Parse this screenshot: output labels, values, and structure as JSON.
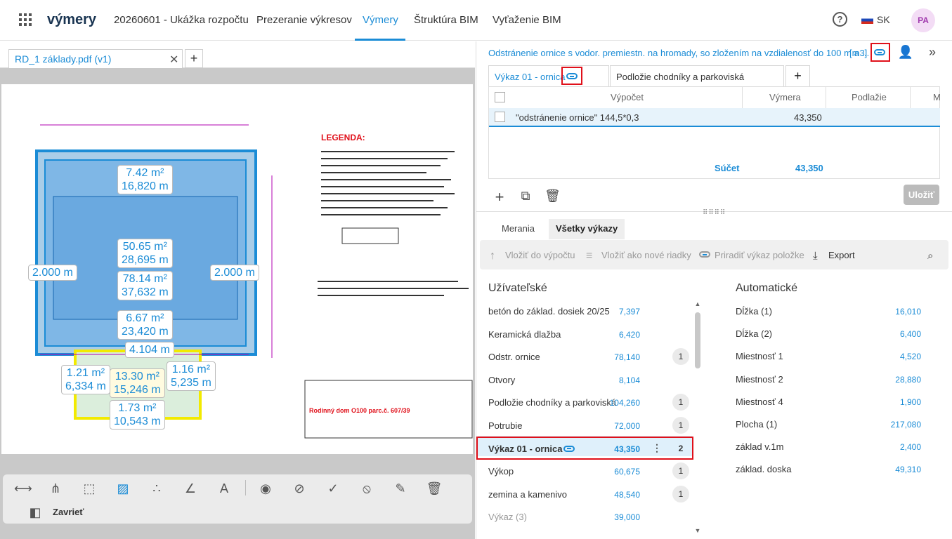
{
  "app": {
    "logo": "výmery",
    "project": "20260601 - Ukážka rozpočtu",
    "lang": "SK",
    "user": "PA"
  },
  "nav": [
    "Prezeranie výkresov",
    "Výmery",
    "Štruktúra BIM",
    "Vyťaženie BIM"
  ],
  "file_tab": {
    "label": "RD_1 základy.pdf (v1)",
    "add": "+"
  },
  "drawing": {
    "legend_title": "LEGENDA:",
    "labels": [
      {
        "area": "7.42 m²",
        "len": "16,820 m"
      },
      {
        "area": "50.65 m²",
        "len": "28,695 m"
      },
      {
        "area": "78.14 m²",
        "len": "37,632 m"
      },
      {
        "area": "6.67 m²",
        "len": "23,420 m"
      },
      {
        "len": "4.104 m"
      },
      {
        "len": "2.000 m"
      },
      {
        "len": "2.000 m"
      },
      {
        "area": "1.21 m²",
        "len": "6,334 m"
      },
      {
        "area": "13.30 m²",
        "len": "15,246 m"
      },
      {
        "area": "1.16 m²",
        "len": "5,235 m"
      },
      {
        "area": "1.73 m²",
        "len": "10,543 m"
      }
    ],
    "title_block": "Rodinný dom O100 parc.č. 607/39"
  },
  "toolbar": {
    "close": "Zavrieť"
  },
  "item": {
    "title": "Odstránenie ornice s vodor. premiestn. na hromady, so zložením na vzdialenosť do 100 m a ...",
    "unit": "[m3]"
  },
  "tabs": [
    {
      "label": "Výkaz 01 - ornica"
    },
    {
      "label": "Podložie chodníky a parkoviská"
    }
  ],
  "table": {
    "headers": [
      "Výpočet",
      "Výmera",
      "Podlažie",
      "M"
    ],
    "rows": [
      {
        "calc": "\"odstránenie ornice\" 144,5*0,3",
        "value": "43,350"
      }
    ],
    "sum_label": "Súčet",
    "sum_value": "43,350"
  },
  "save": "Uložiť",
  "bottom_tabs": [
    "Merania",
    "Všetky výkazy"
  ],
  "actions": [
    "Vložiť do výpočtu",
    "Vložiť ako nové riadky",
    "Priradiť výkaz položke",
    "Export"
  ],
  "user_title": "Užívateľské",
  "auto_title": "Automatické",
  "user_items": [
    {
      "name": "betón do základ. dosiek 20/25",
      "value": "7,397",
      "count": ""
    },
    {
      "name": "Keramická dlažba",
      "value": "6,420",
      "count": ""
    },
    {
      "name": "Odstr. ornice",
      "value": "78,140",
      "count": "1"
    },
    {
      "name": "Otvory",
      "value": "8,104",
      "count": ""
    },
    {
      "name": "Podložie chodníky a parkoviská",
      "value": "104,260",
      "count": "1"
    },
    {
      "name": "Potrubie",
      "value": "72,000",
      "count": "1"
    },
    {
      "name": "Výkaz 01 - ornica",
      "value": "43,350",
      "count": "2"
    },
    {
      "name": "Výkop",
      "value": "60,675",
      "count": "1"
    },
    {
      "name": "zemina a kamenivo",
      "value": "48,540",
      "count": "1"
    },
    {
      "name": "Výkaz (3)",
      "value": "39,000",
      "count": ""
    }
  ],
  "auto_items": [
    {
      "name": "Dĺžka (1)",
      "value": "16,010"
    },
    {
      "name": "Dĺžka (2)",
      "value": "6,400"
    },
    {
      "name": "Miestnosť 1",
      "value": "4,520"
    },
    {
      "name": "Miestnosť 2",
      "value": "28,880"
    },
    {
      "name": "Miestnosť 4",
      "value": "1,900"
    },
    {
      "name": "Plocha (1)",
      "value": "217,080"
    },
    {
      "name": "základ v.1m",
      "value": "2,400"
    },
    {
      "name": "základ. doska",
      "value": "49,310"
    }
  ],
  "colors": {
    "accent": "#1b8cd6",
    "highlight": "#e0101a"
  }
}
